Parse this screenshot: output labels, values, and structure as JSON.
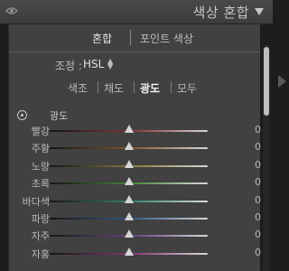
{
  "header": {
    "title": "색상 혼합"
  },
  "modes": {
    "mix": "혼합",
    "point": "포인트 색상"
  },
  "adjust": {
    "label": "조정 :",
    "value": "HSL"
  },
  "tabs": [
    {
      "label": "색조",
      "active": false
    },
    {
      "label": "채도",
      "active": false
    },
    {
      "label": "광도",
      "active": true
    },
    {
      "label": "모두",
      "active": false
    }
  ],
  "section": {
    "label": "광도"
  },
  "sliders": [
    {
      "label": "빨강",
      "value": "0",
      "color": "#8a3a3a"
    },
    {
      "label": "주황",
      "value": "0",
      "color": "#8a5e33"
    },
    {
      "label": "노랑",
      "value": "0",
      "color": "#8a8040"
    },
    {
      "label": "초록",
      "value": "0",
      "color": "#4a8a3c"
    },
    {
      "label": "바다색",
      "value": "0",
      "color": "#3c8a7a"
    },
    {
      "label": "파랑",
      "value": "0",
      "color": "#3a5e8a"
    },
    {
      "label": "자주",
      "value": "0",
      "color": "#6a4a8a"
    },
    {
      "label": "자홍",
      "value": "0",
      "color": "#8a3c7a"
    }
  ]
}
